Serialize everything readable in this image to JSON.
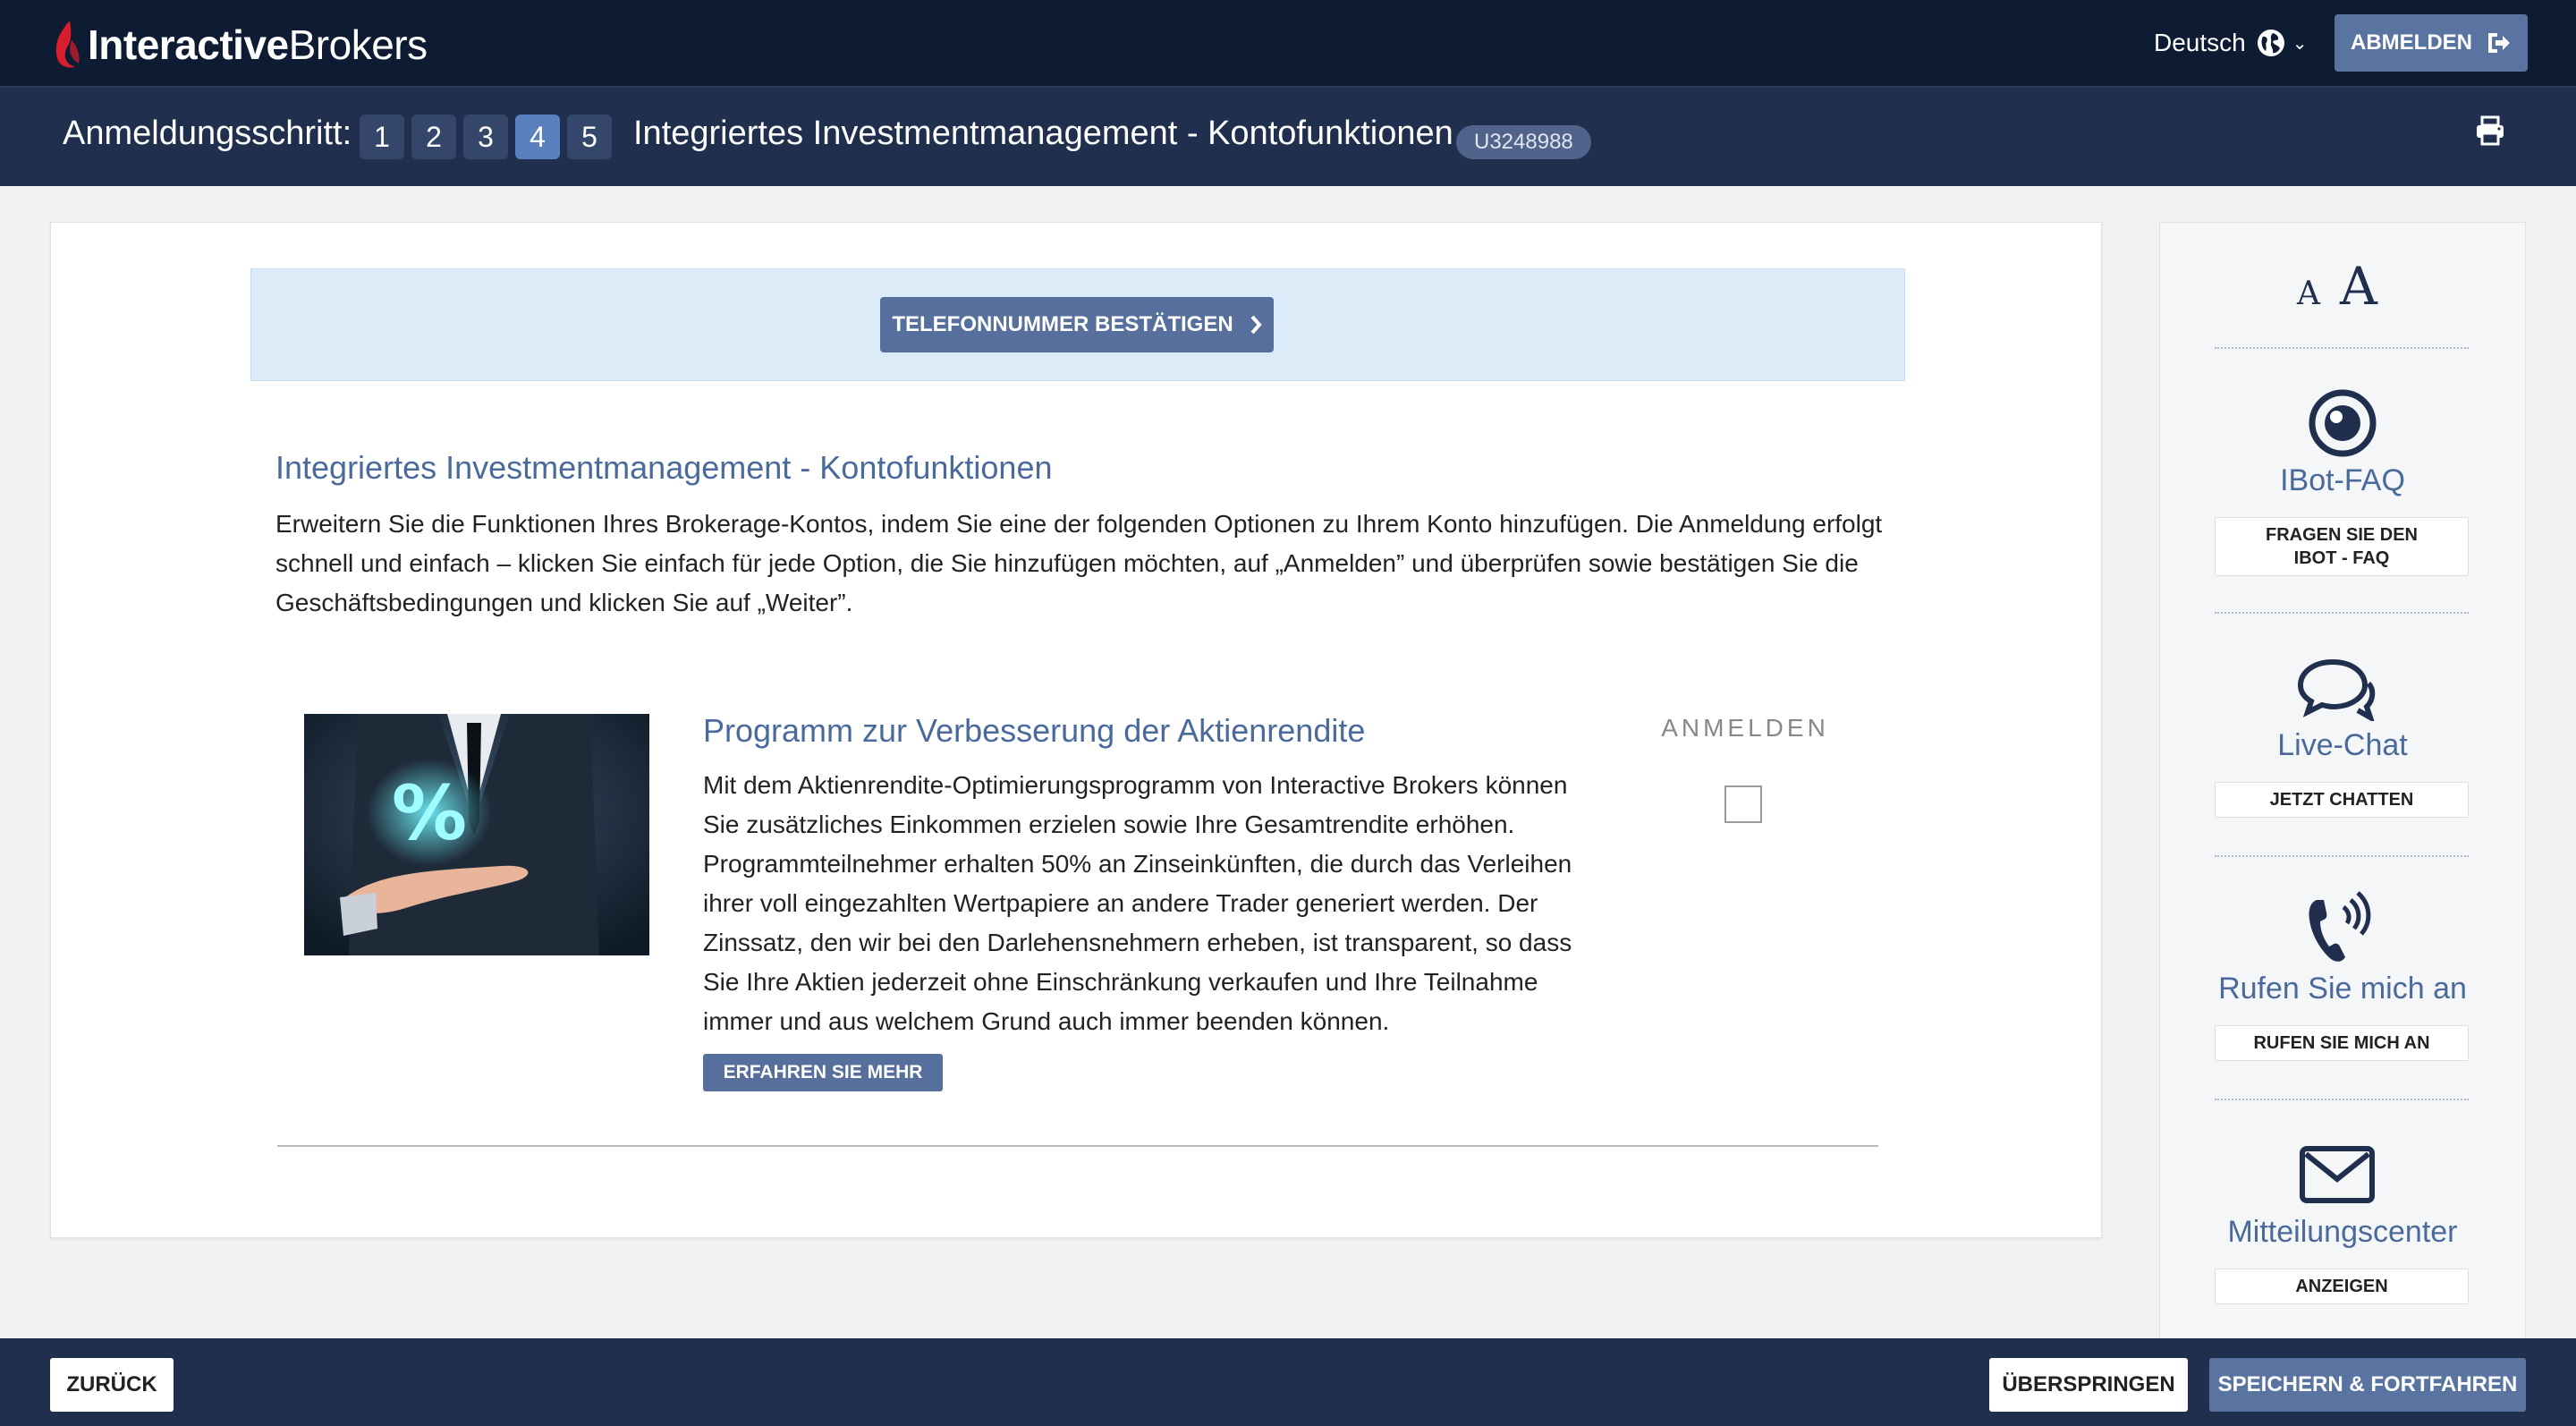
{
  "header": {
    "brand_bold": "Interactive",
    "brand_light": "Brokers",
    "language": "Deutsch",
    "logout_label": "ABMELDEN"
  },
  "stepbar": {
    "label": "Anmeldungsschritt:",
    "steps": [
      "1",
      "2",
      "3",
      "4",
      "5"
    ],
    "active_step": "4",
    "title": "Integriertes Investmentmanagement - Kontofunktionen",
    "account_id": "U3248988"
  },
  "main": {
    "phone_button": "TELEFONNUMMER BESTÄTIGEN",
    "section_title": "Integriertes Investmentmanagement - Kontofunktionen",
    "section_description": "Erweitern Sie die Funktionen Ihres Brokerage-Kontos, indem Sie eine der folgenden Optionen zu Ihrem Konto hinzufügen. Die Anmeldung erfolgt schnell und einfach – klicken Sie einfach für jede Option, die Sie hinzufügen möchten, auf „Anmelden” und überprüfen sowie bestätigen Sie die Geschäftsbedingungen und klicken Sie auf „Weiter”.",
    "product": {
      "image_symbol": "%",
      "title": "Programm zur Verbesserung der Aktienrendite",
      "description": "Mit dem Aktienrendite-Optimierungsprogramm von Interactive Brokers können Sie zusätzliches Einkommen erzielen sowie Ihre Gesamtrendite erhöhen. Programmteilnehmer erhalten 50% an Zinseinkünften, die durch das Verleihen ihrer voll eingezahlten Wertpapiere an andere Trader generiert werden. Der Zinssatz, den wir bei den Darlehensnehmern erheben, ist transparent, so dass Sie Ihre Aktien jederzeit ohne Einschränkung verkaufen und Ihre Teilnahme immer und aus welchem Grund auch immer beenden können.",
      "learn_more": "ERFAHREN SIE MEHR",
      "enroll_label": "ANMELDEN",
      "enrolled": false
    }
  },
  "sidebar": {
    "font_small": "A",
    "font_large": "A",
    "items": [
      {
        "icon": "ibot-icon",
        "title": "IBot-FAQ",
        "button": "FRAGEN SIE DEN IBOT - FAQ"
      },
      {
        "icon": "chat-icon",
        "title": "Live-Chat",
        "button": "JETZT CHATTEN"
      },
      {
        "icon": "phone-icon",
        "title": "Rufen Sie mich an",
        "button": "RUFEN SIE MICH AN"
      },
      {
        "icon": "mail-icon",
        "title": "Mitteilungscenter",
        "button": "ANZEIGEN"
      }
    ]
  },
  "footer": {
    "back": "ZURÜCK",
    "skip": "ÜBERSPRINGEN",
    "save": "SPEICHERN & FORTFAHREN"
  },
  "colors": {
    "header_bg": "#0d1b33",
    "stepbar_bg": "#1f2f4d",
    "accent_button": "#5a74a2",
    "title_blue": "#4a6a9c",
    "banner_bg": "#dcebf8",
    "logo_red": "#d81e2c"
  }
}
